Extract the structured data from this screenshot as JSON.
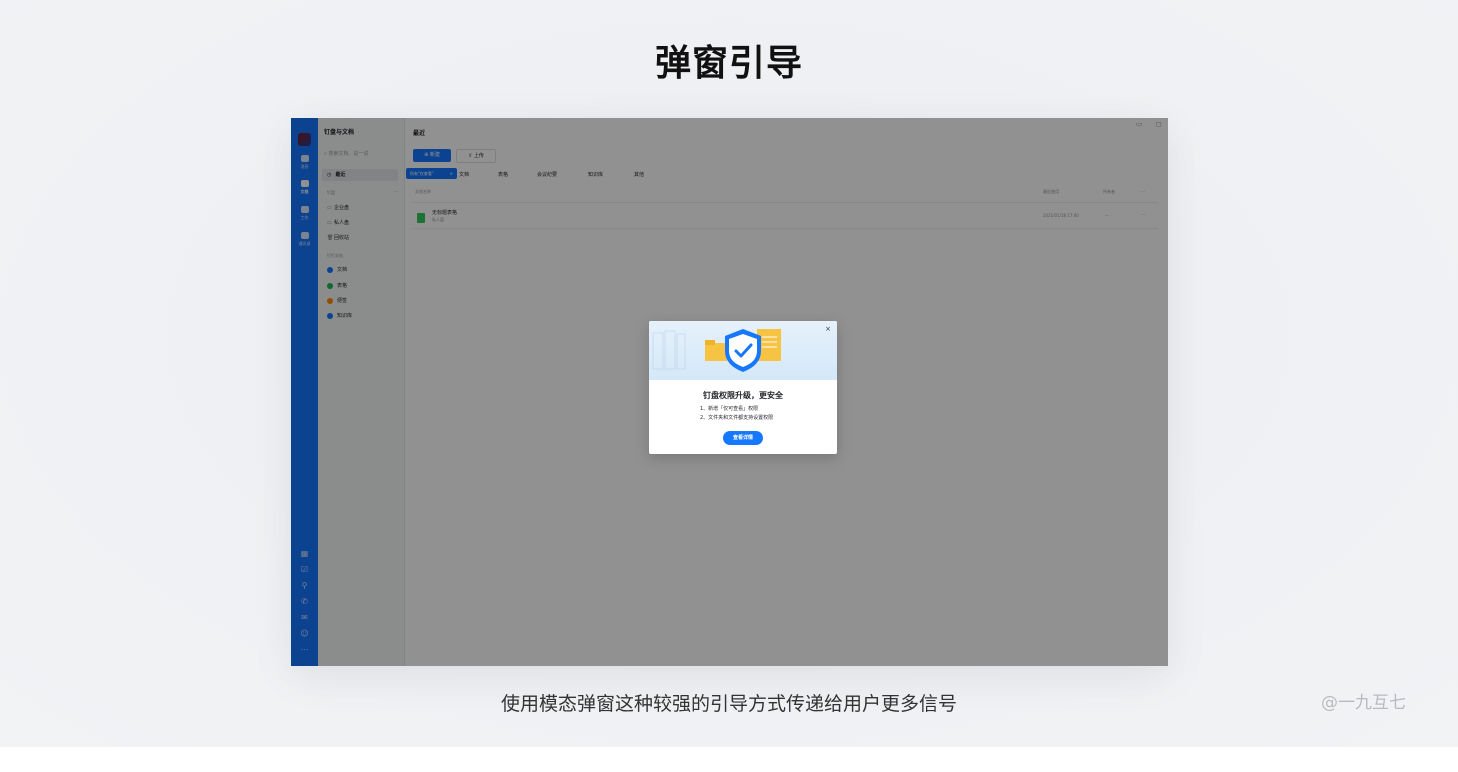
{
  "page": {
    "heading": "弹窗引导",
    "caption": "使用模态弹窗这种较强的引导方式传递给用户更多信号",
    "watermark": "@一九互七"
  },
  "rail": {
    "items": [
      {
        "label": "消息"
      },
      {
        "label": "文档"
      },
      {
        "label": "工作"
      },
      {
        "label": "通讯录"
      }
    ],
    "bottom_icons": [
      "grid-icon",
      "check-icon",
      "pin-icon",
      "phone-icon",
      "mail-icon",
      "sticker-icon",
      "more-icon"
    ]
  },
  "sidebar": {
    "title": "钉盘与文档",
    "search_placeholder": "搜索文档、说一说",
    "recent": "最近",
    "section_pan": "钉盘",
    "pan_items": [
      "企业盘",
      "私人盘",
      "回收站"
    ],
    "section_docs": "钉钉文档",
    "doc_items": [
      {
        "label": "文档",
        "color": "#1677ff"
      },
      {
        "label": "表格",
        "color": "#1bb55c"
      },
      {
        "label": "便签",
        "color": "#ff8a00"
      },
      {
        "label": "知识库",
        "color": "#1677ff"
      }
    ]
  },
  "main": {
    "title": "最近",
    "new_button": "新建",
    "upload_button": "上传",
    "filter_chip": "所有\"仅查看\"",
    "tabs": [
      "文档",
      "表格",
      "会议纪要",
      "知识库",
      "其他"
    ],
    "col_name": "文档名称",
    "col_time": "最近使用",
    "col_owner": "所有者",
    "file": {
      "name": "无标题表格",
      "location": "私人盘",
      "time": "2021/01/18 17:00",
      "owner": "—"
    }
  },
  "modal": {
    "title": "钉盘权限升级，更安全",
    "line1": "1、新增「仅可查看」权限",
    "line2": "2、文件夹和文件都支持设置权限",
    "button": "查看详情",
    "accent": "#1677ff"
  }
}
